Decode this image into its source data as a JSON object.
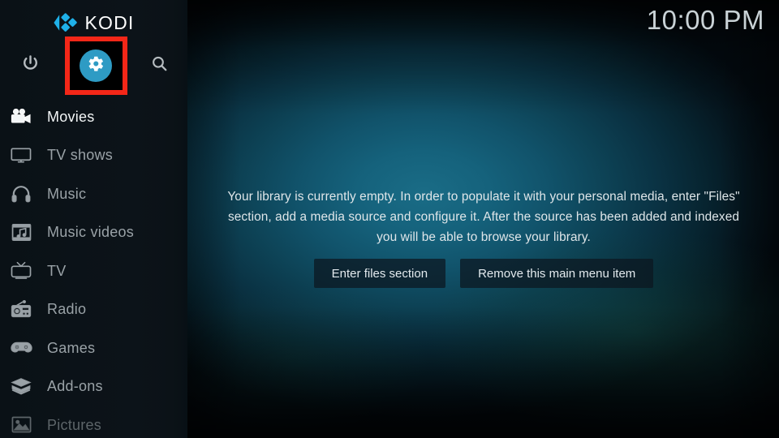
{
  "app": {
    "brand_name": "KODI",
    "brand_logo_icon": "kodi-logo-icon"
  },
  "clock": {
    "time": "10:00 PM"
  },
  "topnav": {
    "items": [
      {
        "icon": "power-icon",
        "name": "power-button",
        "label": "Power"
      },
      {
        "icon": "gear-icon",
        "name": "settings-button",
        "label": "Settings",
        "highlighted": true
      },
      {
        "icon": "search-icon",
        "name": "search-button",
        "label": "Search"
      }
    ],
    "highlight_color": "#f42718",
    "gear_disc_color": "#2e9bc4"
  },
  "sidebar": {
    "items": [
      {
        "label": "Movies",
        "icon": "movie-camera-icon",
        "state": "selected"
      },
      {
        "label": "TV shows",
        "icon": "monitor-icon",
        "state": "normal"
      },
      {
        "label": "Music",
        "icon": "headphones-icon",
        "state": "normal"
      },
      {
        "label": "Music videos",
        "icon": "film-music-icon",
        "state": "normal"
      },
      {
        "label": "TV",
        "icon": "retro-tv-icon",
        "state": "normal"
      },
      {
        "label": "Radio",
        "icon": "radio-icon",
        "state": "normal"
      },
      {
        "label": "Games",
        "icon": "gamepad-icon",
        "state": "normal"
      },
      {
        "label": "Add-ons",
        "icon": "open-box-icon",
        "state": "normal"
      },
      {
        "label": "Pictures",
        "icon": "picture-icon",
        "state": "faded"
      }
    ]
  },
  "main": {
    "empty_message": "Your library is currently empty. In order to populate it with your personal media, enter \"Files\" section, add a media source and configure it. After the source has been added and indexed you will be able to browse your library.",
    "buttons": {
      "enter_files": "Enter files section",
      "remove_item": "Remove this main menu item"
    }
  }
}
